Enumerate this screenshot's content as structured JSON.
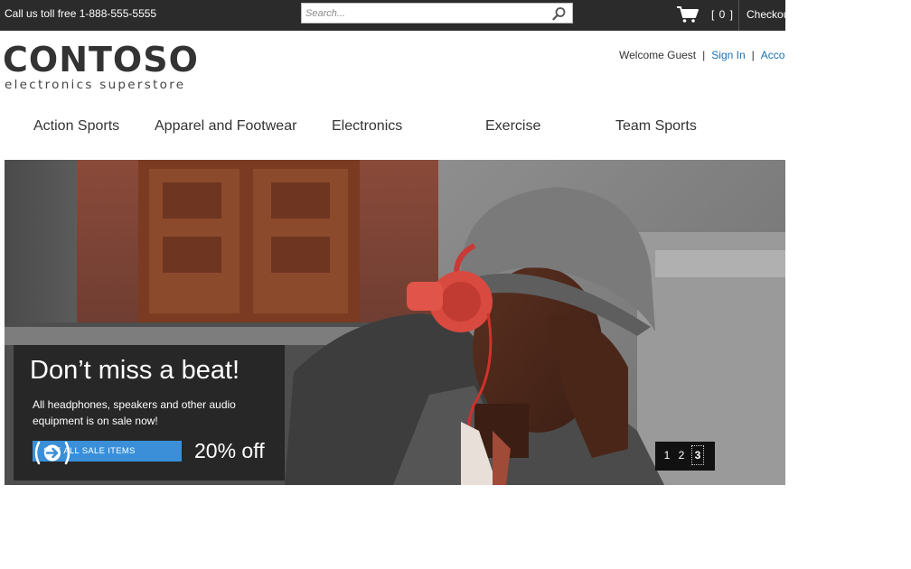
{
  "topbar": {
    "toll_free": "Call us toll free 1-888-555-5555",
    "search_placeholder": "Search...",
    "cart_count": "[ 0 ]",
    "checkout_label": "Checkout"
  },
  "logo": {
    "wordmark": "CONTOSO",
    "tagline": "electronics superstore"
  },
  "account": {
    "welcome": "Welcome Guest",
    "sign_in": "Sign In",
    "account": "Account"
  },
  "nav": [
    {
      "label": "Action Sports"
    },
    {
      "label": "Apparel and Footwear"
    },
    {
      "label": "Electronics"
    },
    {
      "label": "Exercise"
    },
    {
      "label": "Team Sports"
    }
  ],
  "hero": {
    "title": "Don’t miss a beat!",
    "text": "All headphones, speakers and other audio equipment is on sale now!",
    "button_label": "SEE ALL SALE ITEMS",
    "discount": "20% off",
    "pager": [
      "1",
      "2",
      "3"
    ],
    "active_page": "3"
  },
  "colors": {
    "topbar_bg": "#2b2b2b",
    "link": "#1a6fb5",
    "button": "#3a8fd8"
  }
}
